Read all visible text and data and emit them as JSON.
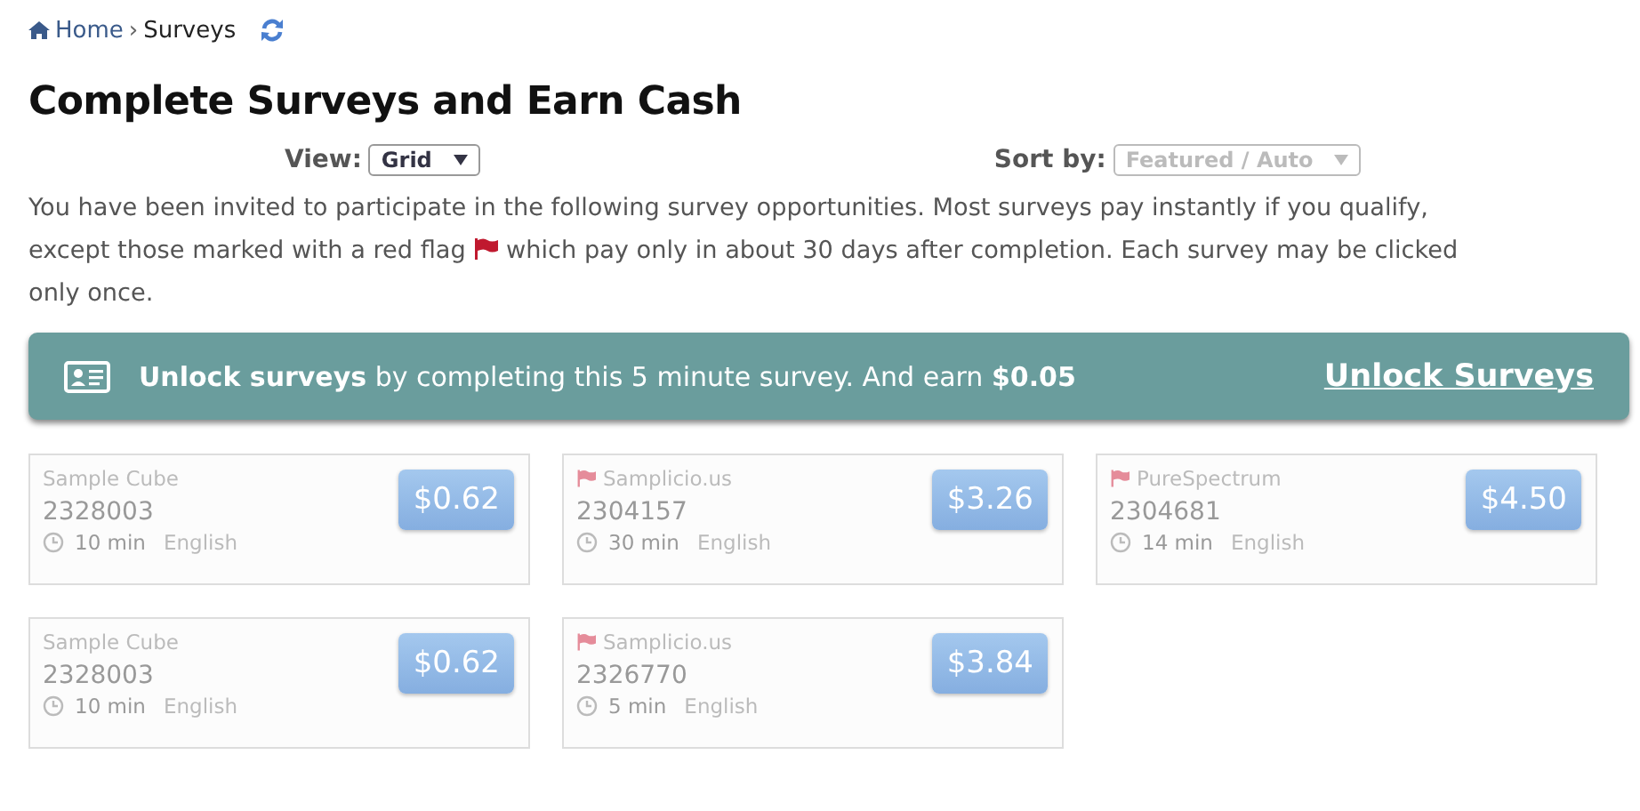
{
  "breadcrumb": {
    "home": "Home",
    "separator": "›",
    "current": "Surveys"
  },
  "title": "Complete Surveys and Earn Cash",
  "view": {
    "label": "View:",
    "value": "Grid",
    "disabled": false
  },
  "sort": {
    "label": "Sort by:",
    "value": "Featured / Auto",
    "disabled": true
  },
  "intro": {
    "line_1": "You have been invited to participate in the following survey opportunities. Most surveys pay instantly if you qualify,",
    "line_2_before_flag": "except those marked with a red flag",
    "line_2_after_flag": "which pay only in about 30 days after completion. Each survey may be clicked",
    "line_3": "only once."
  },
  "banner": {
    "text": "**Unlock surveys** by completing this 5 minute survey. And earn **$0.05**",
    "link": "Unlock Surveys"
  },
  "surveys": [
    {
      "provider": "Sample Cube",
      "id": "2328003",
      "duration": "10 min",
      "language": "English",
      "price": "$0.62",
      "flagged": false
    },
    {
      "provider": "Samplicio.us",
      "id": "2304157",
      "duration": "30 min",
      "language": "English",
      "price": "$3.26",
      "flagged": true
    },
    {
      "provider": "PureSpectrum",
      "id": "2304681",
      "duration": "14 min",
      "language": "English",
      "price": "$4.50",
      "flagged": true
    },
    {
      "provider": "Sample Cube",
      "id": "2328003",
      "duration": "10 min",
      "language": "English",
      "price": "$0.62",
      "flagged": false
    },
    {
      "provider": "Samplicio.us",
      "id": "2326770",
      "duration": "5 min",
      "language": "English",
      "price": "$3.84",
      "flagged": true
    }
  ]
}
